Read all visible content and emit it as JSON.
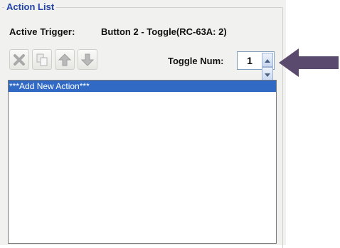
{
  "group": {
    "title": "Action List"
  },
  "trigger": {
    "label": "Active Trigger:",
    "value": "Button 2 - Toggle(RC-63A: 2)"
  },
  "toolbar": {
    "buttons": [
      {
        "name": "delete-action-button",
        "icon": "delete-x-icon"
      },
      {
        "name": "copy-action-button",
        "icon": "copy-icon"
      },
      {
        "name": "move-up-button",
        "icon": "arrow-up-icon"
      },
      {
        "name": "move-down-button",
        "icon": "arrow-down-icon"
      }
    ]
  },
  "toggle": {
    "label": "Toggle Num:",
    "value": "1"
  },
  "list": {
    "items": [
      "***Add New Action***"
    ],
    "selected_index": 0
  },
  "colors": {
    "title": "#2244a8",
    "selection": "#316ac5",
    "callout_arrow": "#5a4a6e"
  }
}
